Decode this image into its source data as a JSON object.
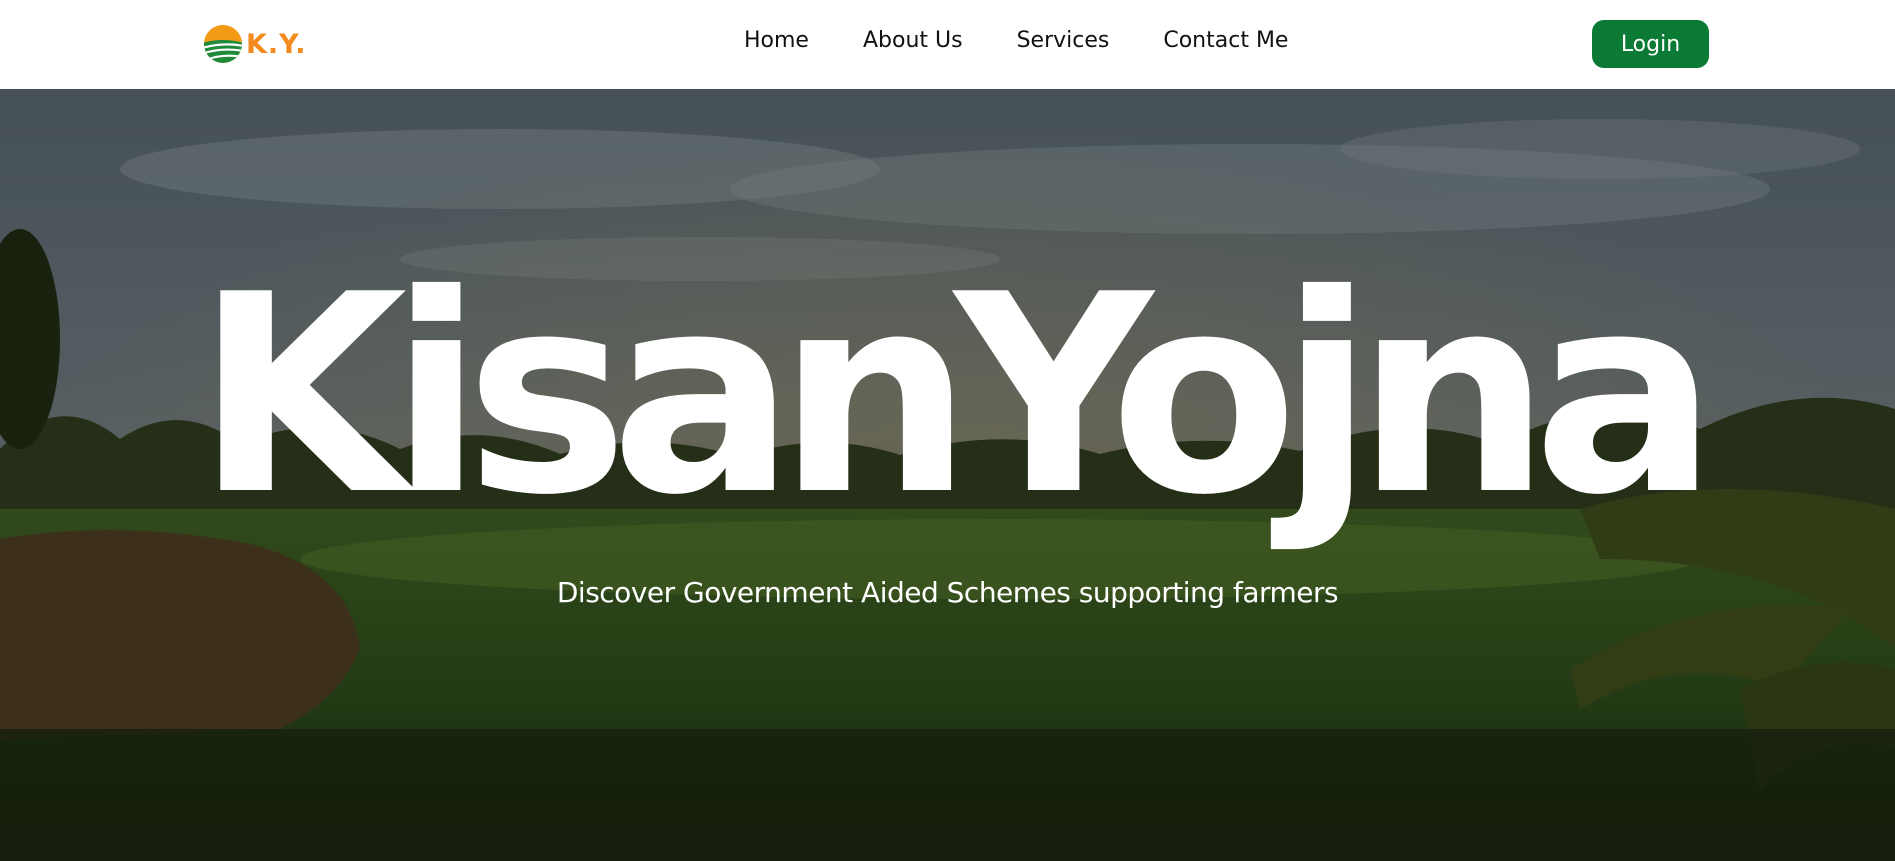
{
  "brand": {
    "logo_text": "K.Y.",
    "logo_icon": "sun-field-icon",
    "accent": "#f28a1e",
    "green": "#0b7a35"
  },
  "nav": {
    "items": [
      {
        "label": "Home"
      },
      {
        "label": "About Us"
      },
      {
        "label": "Services"
      },
      {
        "label": "Contact Me"
      }
    ],
    "login_label": "Login"
  },
  "hero": {
    "title": "KisanYojna",
    "subtitle": "Discover Government Aided Schemes supporting farmers"
  }
}
